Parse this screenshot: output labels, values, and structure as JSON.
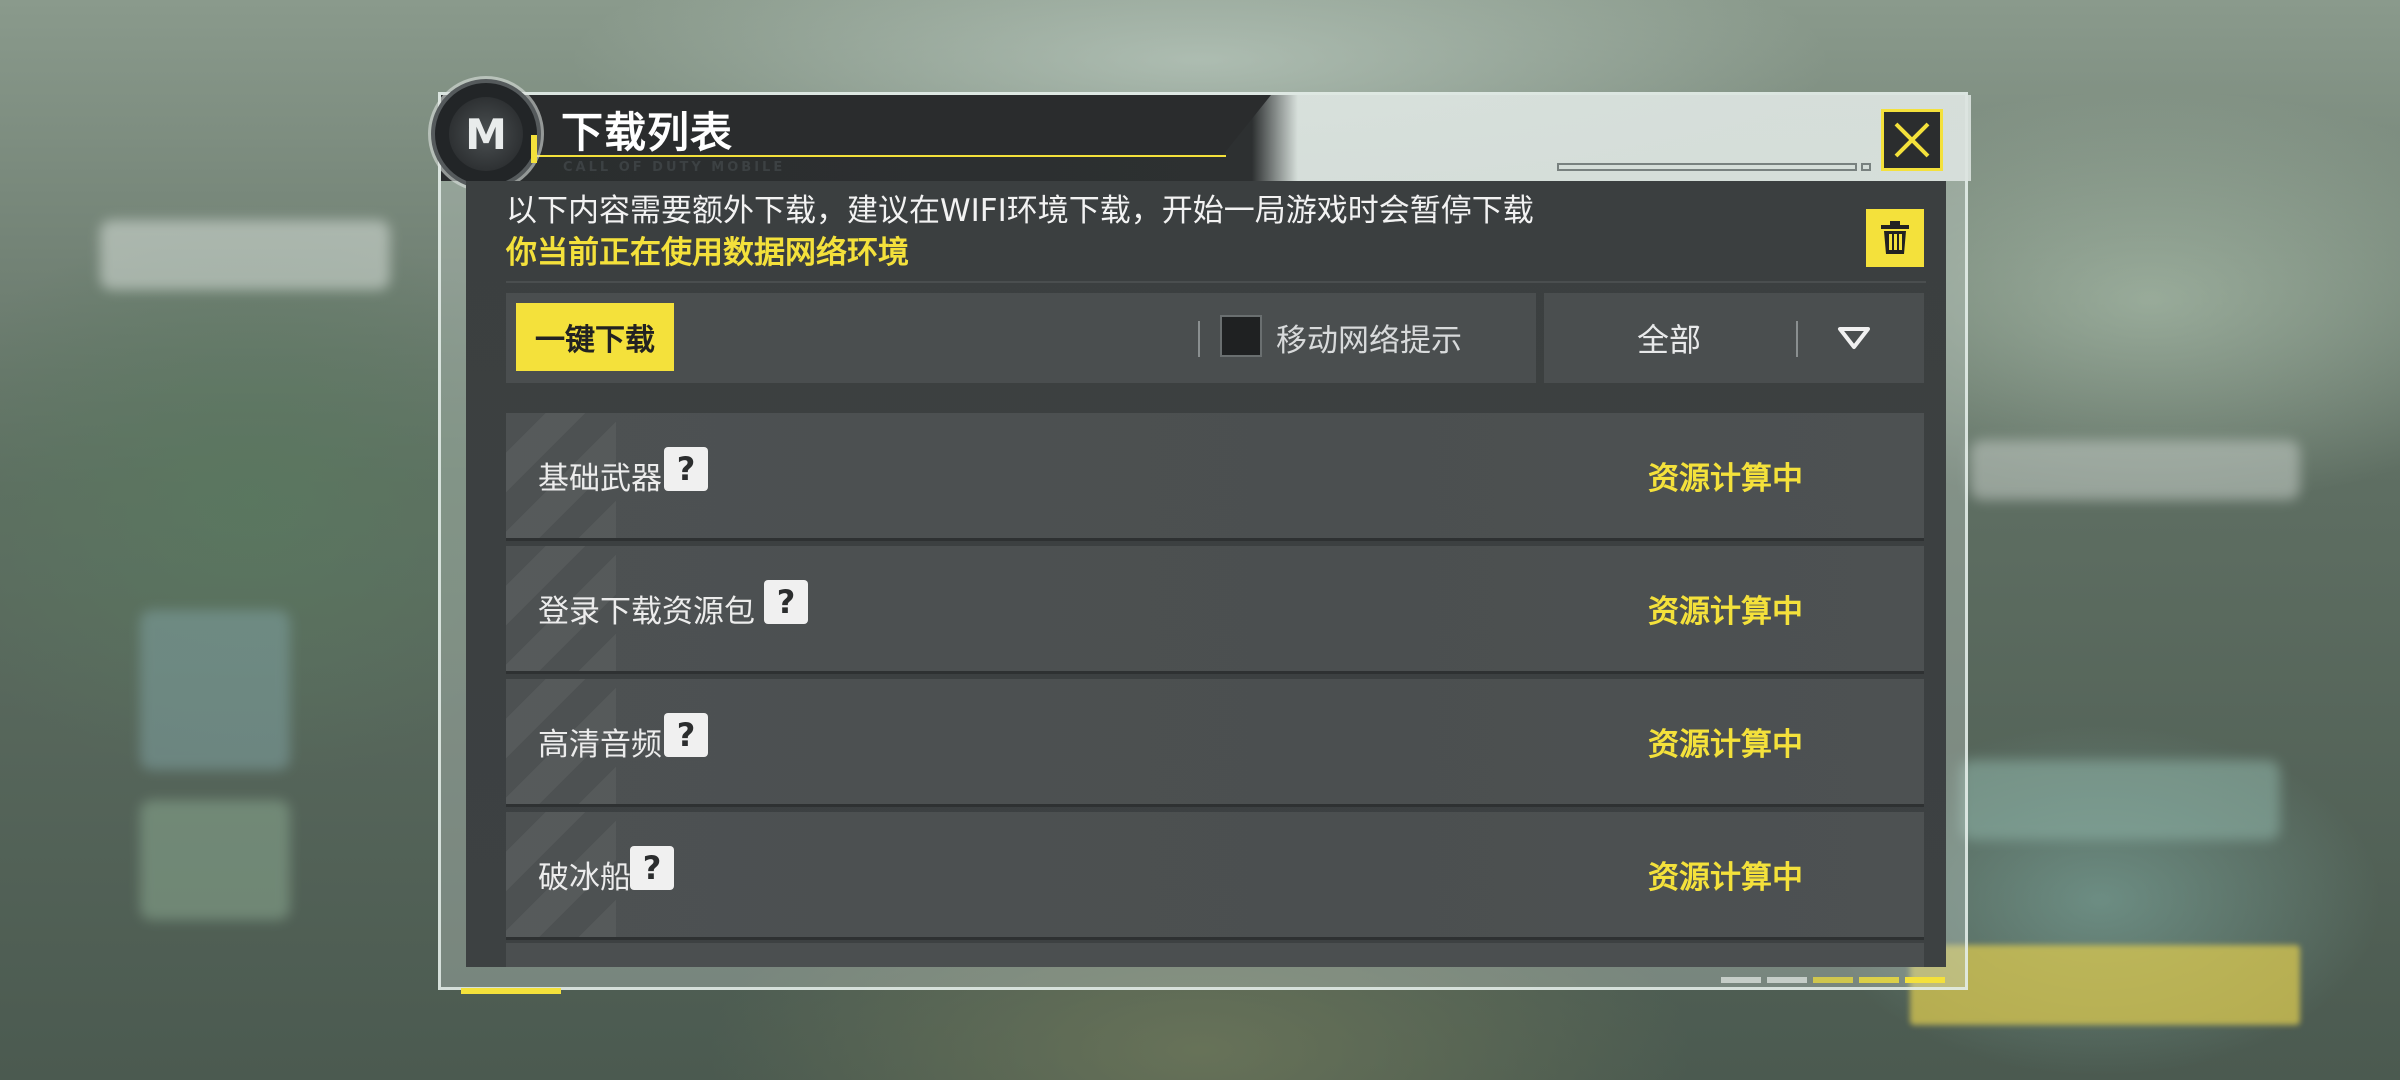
{
  "dialog": {
    "title": "下载列表",
    "brand": "CALL OF DUTY MOBILE",
    "logo_glyph": "M",
    "close_icon": "close-x-icon",
    "notice": "以下内容需要额外下载，建议在WIFI环境下载，开始一局游戏时会暂停下载",
    "network_warning": "你当前正在使用数据网络环境",
    "delete_icon": "trash-icon"
  },
  "toolbar": {
    "onekey_download": "一键下载",
    "mobile_network_prompt": "移动网络提示",
    "filter_value": "全部",
    "filter_icon": "triangle-down-icon"
  },
  "items": [
    {
      "name": "基础武器",
      "status": "资源计算中"
    },
    {
      "name": "登录下载资源包",
      "status": "资源计算中"
    },
    {
      "name": "高清音频",
      "status": "资源计算中"
    },
    {
      "name": "破冰船",
      "status": "资源计算中"
    }
  ],
  "help_glyph": "?",
  "colors": {
    "accent": "#f4e13b",
    "panel": "#3b3f40",
    "row": "#4d5152"
  }
}
